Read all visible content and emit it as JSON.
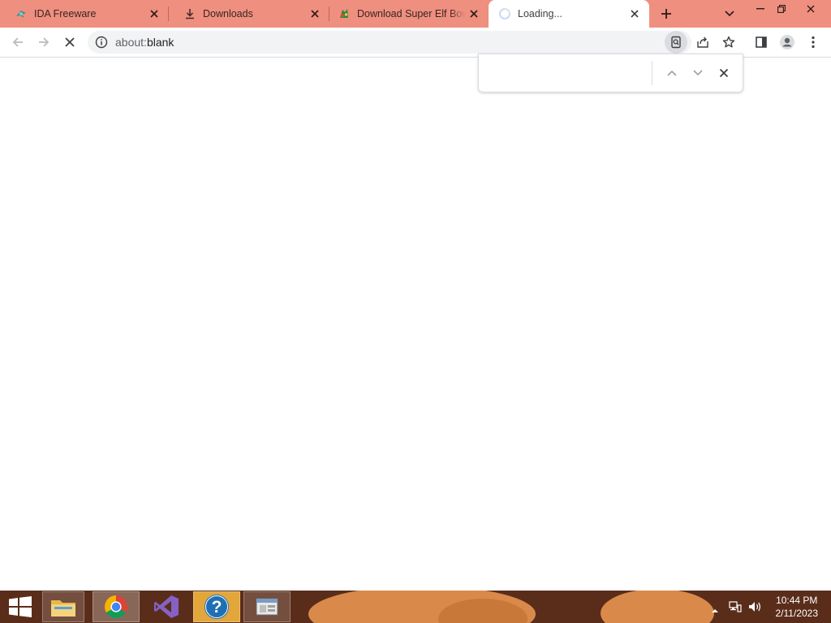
{
  "browser": {
    "tabs": [
      {
        "title": "IDA Freeware",
        "icon": "ida-favicon",
        "active": false
      },
      {
        "title": "Downloads",
        "icon": "download-icon",
        "active": false
      },
      {
        "title": "Download Super Elf Bowling",
        "icon": "elf-favicon",
        "active": false
      },
      {
        "title": "Loading...",
        "icon": "loading-spinner-icon",
        "active": true
      }
    ],
    "new_tab_icon": "plus-icon",
    "tab_search_icon": "chevron-down-icon",
    "window_controls": [
      "minimize-icon",
      "restore-icon",
      "close-icon"
    ]
  },
  "toolbar": {
    "address": {
      "scheme": "about:",
      "rest": "blank"
    },
    "site_info_icon": "info-icon",
    "page_actions": [
      "zoom-search-icon",
      "share-icon",
      "bookmark-star-icon"
    ],
    "right_icons": [
      "side-panel-icon",
      "profile-icon",
      "menu-kebab-icon"
    ]
  },
  "find_bar": {
    "query": "",
    "controls": [
      "chevron-up-icon",
      "chevron-down-icon",
      "close-icon"
    ]
  },
  "taskbar": {
    "apps": [
      "windows-start-icon",
      "file-explorer-icon",
      "chrome-icon",
      "visual-studio-icon",
      "help-icon",
      "control-panel-icon"
    ],
    "tray": [
      "show-hidden-icon",
      "network-icon",
      "volume-icon"
    ],
    "clock": {
      "time": "10:44 PM",
      "date": "2/11/2023"
    }
  },
  "colors": {
    "tabstrip": "#ee8f80",
    "taskbar": "#5a2d1a",
    "accent": "#1a73e8"
  }
}
